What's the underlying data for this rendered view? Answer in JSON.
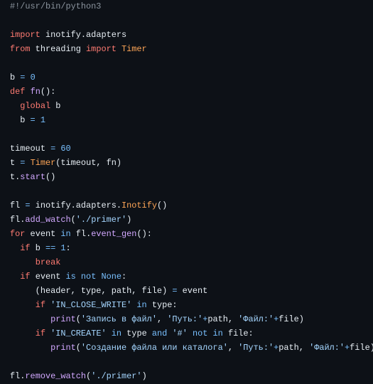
{
  "code_block": {
    "language": "python",
    "colors": {
      "background": "#0d1117",
      "keyword": "#ff7b72",
      "function": "#d2a8ff",
      "number": "#79c0ff",
      "string": "#a5d6ff",
      "class": "#ffa657",
      "comment": "#8b949e",
      "text": "#e6edf3"
    },
    "lines": [
      [
        [
          "cm",
          "#!/usr/bin/python3"
        ]
      ],
      [],
      [
        [
          "kw",
          "import"
        ],
        [
          "tx",
          " inotify.adapters"
        ]
      ],
      [
        [
          "kw",
          "from"
        ],
        [
          "tx",
          " threading "
        ],
        [
          "kw",
          "import"
        ],
        [
          "tx",
          " "
        ],
        [
          "cls",
          "Timer"
        ]
      ],
      [],
      [
        [
          "tx",
          "b "
        ],
        [
          "op",
          "="
        ],
        [
          "tx",
          " "
        ],
        [
          "num",
          "0"
        ]
      ],
      [
        [
          "kw",
          "def"
        ],
        [
          "tx",
          " "
        ],
        [
          "fn",
          "fn"
        ],
        [
          "tx",
          "():"
        ]
      ],
      [
        [
          "tx",
          "  "
        ],
        [
          "kw",
          "global"
        ],
        [
          "tx",
          " b"
        ]
      ],
      [
        [
          "tx",
          "  b "
        ],
        [
          "op",
          "="
        ],
        [
          "tx",
          " "
        ],
        [
          "num",
          "1"
        ]
      ],
      [],
      [
        [
          "tx",
          "timeout "
        ],
        [
          "op",
          "="
        ],
        [
          "tx",
          " "
        ],
        [
          "num",
          "60"
        ]
      ],
      [
        [
          "tx",
          "t "
        ],
        [
          "op",
          "="
        ],
        [
          "tx",
          " "
        ],
        [
          "cls",
          "Timer"
        ],
        [
          "tx",
          "(timeout, fn)"
        ]
      ],
      [
        [
          "tx",
          "t."
        ],
        [
          "fn",
          "start"
        ],
        [
          "tx",
          "()"
        ]
      ],
      [],
      [
        [
          "tx",
          "fl "
        ],
        [
          "op",
          "="
        ],
        [
          "tx",
          " inotify.adapters."
        ],
        [
          "cls",
          "Inotify"
        ],
        [
          "tx",
          "()"
        ]
      ],
      [
        [
          "tx",
          "fl."
        ],
        [
          "fn",
          "add_watch"
        ],
        [
          "tx",
          "("
        ],
        [
          "str",
          "'./primer'"
        ],
        [
          "tx",
          ")"
        ]
      ],
      [
        [
          "kw",
          "for"
        ],
        [
          "tx",
          " event "
        ],
        [
          "op",
          "in"
        ],
        [
          "tx",
          " fl."
        ],
        [
          "fn",
          "event_gen"
        ],
        [
          "tx",
          "():"
        ]
      ],
      [
        [
          "tx",
          "  "
        ],
        [
          "kw",
          "if"
        ],
        [
          "tx",
          " b "
        ],
        [
          "op",
          "=="
        ],
        [
          "tx",
          " "
        ],
        [
          "num",
          "1"
        ],
        [
          "tx",
          ":"
        ]
      ],
      [
        [
          "tx",
          "     "
        ],
        [
          "kw",
          "break"
        ]
      ],
      [
        [
          "tx",
          "  "
        ],
        [
          "kw",
          "if"
        ],
        [
          "tx",
          " event "
        ],
        [
          "op",
          "is not"
        ],
        [
          "tx",
          " "
        ],
        [
          "num",
          "None"
        ],
        [
          "tx",
          ":"
        ]
      ],
      [
        [
          "tx",
          "     (header, type, path, file) "
        ],
        [
          "op",
          "="
        ],
        [
          "tx",
          " event"
        ]
      ],
      [
        [
          "tx",
          "     "
        ],
        [
          "kw",
          "if"
        ],
        [
          "tx",
          " "
        ],
        [
          "str",
          "'IN_CLOSE_WRITE'"
        ],
        [
          "tx",
          " "
        ],
        [
          "op",
          "in"
        ],
        [
          "tx",
          " type:"
        ]
      ],
      [
        [
          "tx",
          "        "
        ],
        [
          "fn",
          "print"
        ],
        [
          "tx",
          "("
        ],
        [
          "str",
          "'Запись в файл'"
        ],
        [
          "tx",
          ", "
        ],
        [
          "str",
          "'Путь:'"
        ],
        [
          "op",
          "+"
        ],
        [
          "tx",
          "path, "
        ],
        [
          "str",
          "'Файл:'"
        ],
        [
          "op",
          "+"
        ],
        [
          "tx",
          "file)"
        ]
      ],
      [
        [
          "tx",
          "     "
        ],
        [
          "kw",
          "if"
        ],
        [
          "tx",
          " "
        ],
        [
          "str",
          "'IN_CREATE'"
        ],
        [
          "tx",
          " "
        ],
        [
          "op",
          "in"
        ],
        [
          "tx",
          " type "
        ],
        [
          "op",
          "and"
        ],
        [
          "tx",
          " "
        ],
        [
          "str",
          "'#'"
        ],
        [
          "tx",
          " "
        ],
        [
          "op",
          "not in"
        ],
        [
          "tx",
          " file:"
        ]
      ],
      [
        [
          "tx",
          "        "
        ],
        [
          "fn",
          "print"
        ],
        [
          "tx",
          "("
        ],
        [
          "str",
          "'Создание файла или каталога'"
        ],
        [
          "tx",
          ", "
        ],
        [
          "str",
          "'Путь:'"
        ],
        [
          "op",
          "+"
        ],
        [
          "tx",
          "path, "
        ],
        [
          "str",
          "'Файл:'"
        ],
        [
          "op",
          "+"
        ],
        [
          "tx",
          "file)"
        ]
      ],
      [],
      [
        [
          "tx",
          "fl."
        ],
        [
          "fn",
          "remove_watch"
        ],
        [
          "tx",
          "("
        ],
        [
          "str",
          "'./primer'"
        ],
        [
          "tx",
          ")"
        ]
      ]
    ]
  }
}
